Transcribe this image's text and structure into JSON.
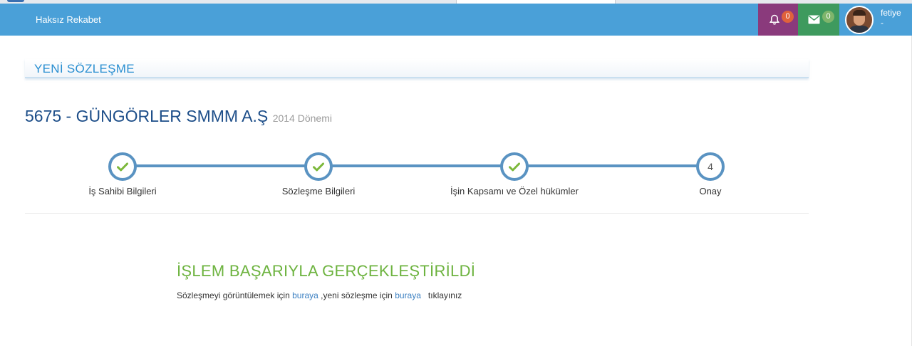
{
  "navbar": {
    "brand": "Haksız Rekabet",
    "notifications": {
      "icon": "bell-icon",
      "count": "0",
      "color": "#8a3a7c"
    },
    "messages": {
      "icon": "envelope-icon",
      "count": "0",
      "color": "#3e9a5e"
    },
    "user": {
      "name": "fetiye",
      "subtitle": "-"
    },
    "color": "#4aa0d8"
  },
  "panel": {
    "title": "YENİ SÖZLEŞME"
  },
  "company": {
    "name": "5675 - GÜNGÖRLER SMMM A.Ş",
    "period": "2014 Dönemi"
  },
  "wizard": {
    "steps": [
      {
        "label": "İş Sahibi Bilgileri",
        "status": "done"
      },
      {
        "label": "Sözleşme Bilgileri",
        "status": "done"
      },
      {
        "label": "İşin Kapsamı ve Özel hükümler",
        "status": "done"
      },
      {
        "label": "Onay",
        "status": "current",
        "number": "4"
      }
    ]
  },
  "result": {
    "title": "İŞLEM BAŞARIYLA GERÇEKLEŞTİRİLDİ",
    "text_before": "Sözleşmeyi görüntülemek için",
    "link1": "buraya",
    "text_middle": ",yeni sözleşme için",
    "link2": "buraya",
    "text_after": "tıklayınız",
    "title_color": "#6db33f"
  }
}
